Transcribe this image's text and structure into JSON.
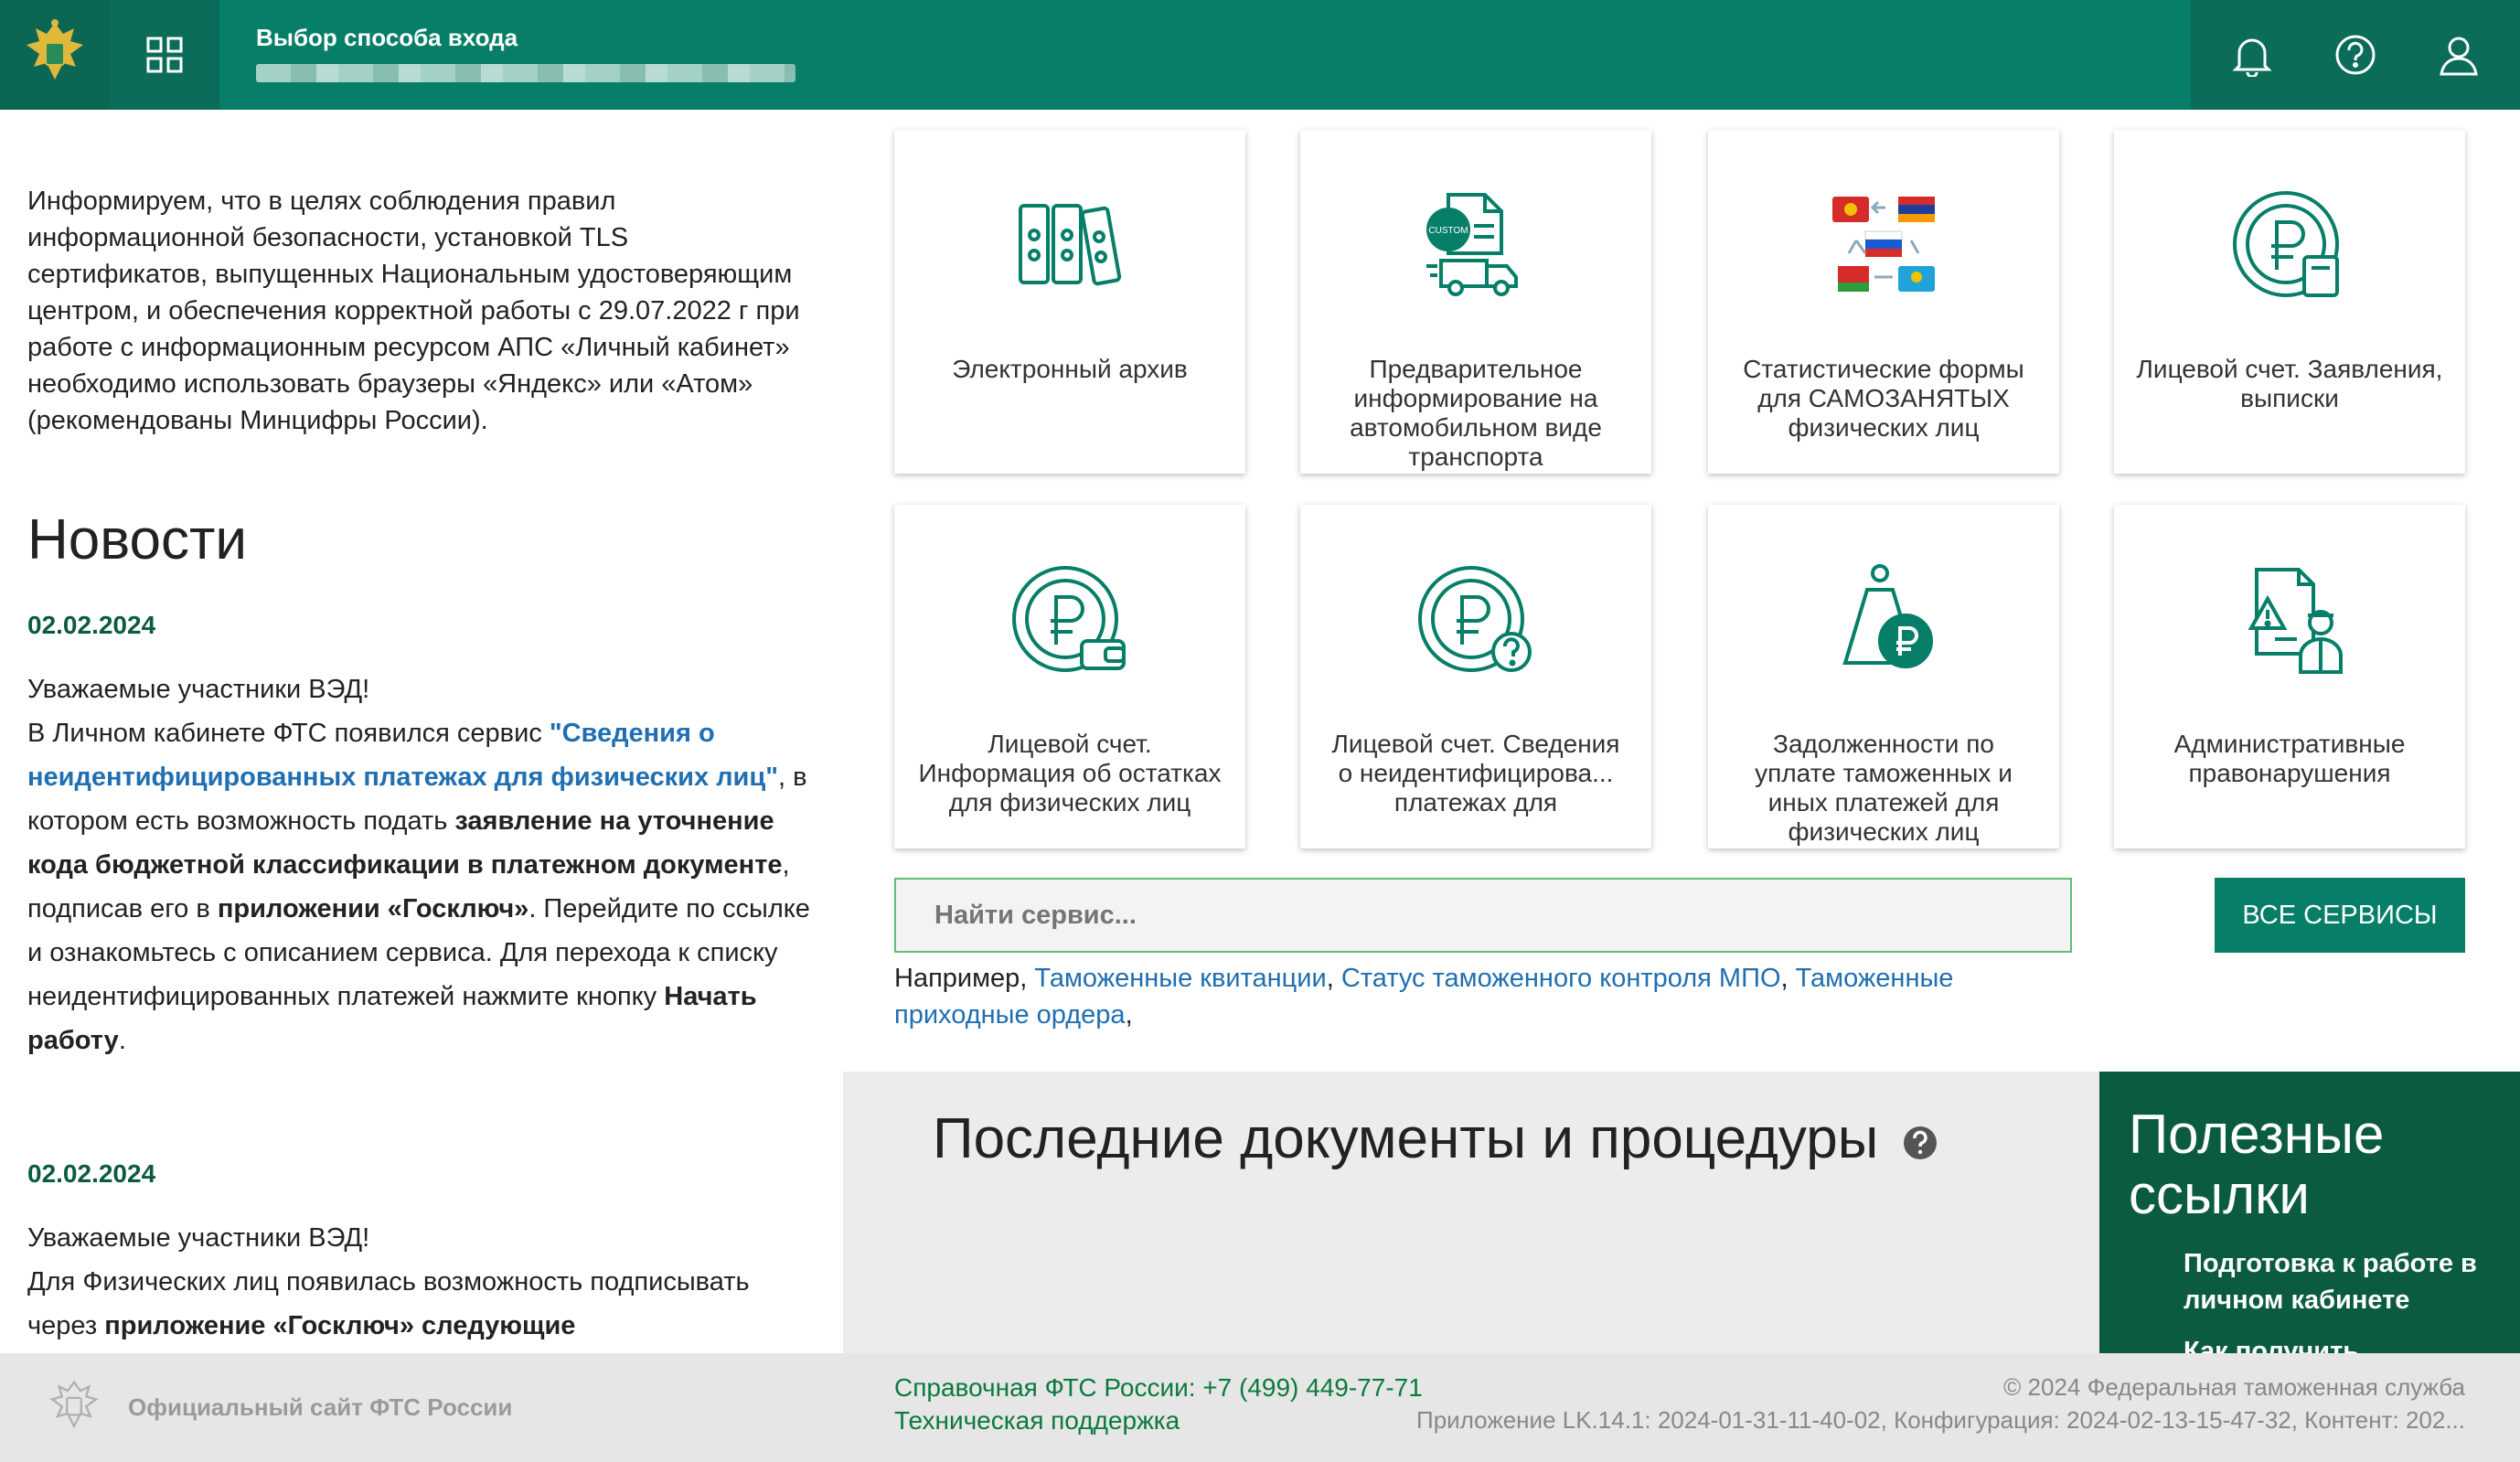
{
  "header": {
    "title": "Выбор способа входа"
  },
  "notice": "Информируем, что в целях соблюдения правил информационной безопасности, установкой TLS сертификатов, выпущенных Национальным удостоверяющим центром, и обеспечения корректной работы с 29.07.2022 г при работе с информационным ресурсом АПС «Личный кабинет» необходимо использовать браузеры «Яндекс» или «Атом» (рекомендованы Минцифры России).",
  "news": {
    "title": "Новости",
    "items": [
      {
        "date": "02.02.2024",
        "greeting": "Уважаемые участники ВЭД!",
        "p1": "В Личном кабинете ФТС появился сервис ",
        "link": "\"Сведения о неидентифицированных платежах для физических лиц\"",
        "p2": ", в котором есть возможность подать ",
        "b1": "заявление на уточнение кода бюджетной классификации в платежном документе",
        "p3": ", подписав его в ",
        "b2": "приложении «Госключ»",
        "p4": ". Перейдите по ссылке и ознакомьтесь с описанием сервиса. Для перехода к списку неидентифицированных платежей нажмите кнопку ",
        "b3": "Начать работу",
        "p5": "."
      },
      {
        "date": "02.02.2024",
        "greeting": "Уважаемые участники ВЭД!",
        "p1": "Для Физических лиц появилась возможность подписывать через ",
        "b1": "приложение «Госключ» следующие"
      }
    ]
  },
  "services": [
    {
      "label": "Электронный архив",
      "icon": "archive-icon"
    },
    {
      "label": "Предварительное информирование на автомобильном виде транспорта",
      "icon": "truck-document-icon"
    },
    {
      "label": "Статистические формы для САМОЗАНЯТЫХ физических лиц",
      "icon": "flags-icon"
    },
    {
      "label": "Лицевой счет. Заявления, выписки",
      "icon": "ruble-document-icon"
    },
    {
      "label": "Лицевой счет. Информация об остатках для физических лиц",
      "icon": "ruble-wallet-icon"
    },
    {
      "label": "Лицевой счет. Сведения о неидентифицирова... платежах для",
      "icon": "ruble-question-icon"
    },
    {
      "label": "Задолженности по уплате таможенных и иных платежей для физических лиц",
      "icon": "ruble-weight-icon"
    },
    {
      "label": "Административные правонарушения",
      "icon": "warning-officer-icon"
    }
  ],
  "search": {
    "placeholder": "Найти сервис...",
    "all_button": "ВСЕ СЕРВИСЫ",
    "examples_label": "Например,",
    "examples": [
      "Таможенные квитанции",
      "Статус таможенного контроля МПО",
      "Таможенные приходные ордера"
    ]
  },
  "recent": {
    "title": "Последние документы и процедуры"
  },
  "useful": {
    "title": "Полезные ссылки",
    "links": [
      "Подготовка к работе в личном кабинете",
      "Как получить"
    ]
  },
  "footer": {
    "site": "Официальный сайт ФТС России",
    "phone": "Справочная ФТС России: +7 (499) 449-77-71",
    "support": "Техническая поддержка",
    "copyright": "© 2024 Федеральная таможенная служба",
    "version": "Приложение LK.14.1: 2024-01-31-11-40-02, Конфигурация: 2024-02-13-15-47-32, Контент: 202..."
  },
  "colors": {
    "brand": "#067e68",
    "dark": "#0b5c3f",
    "link": "#1f6fb2"
  }
}
